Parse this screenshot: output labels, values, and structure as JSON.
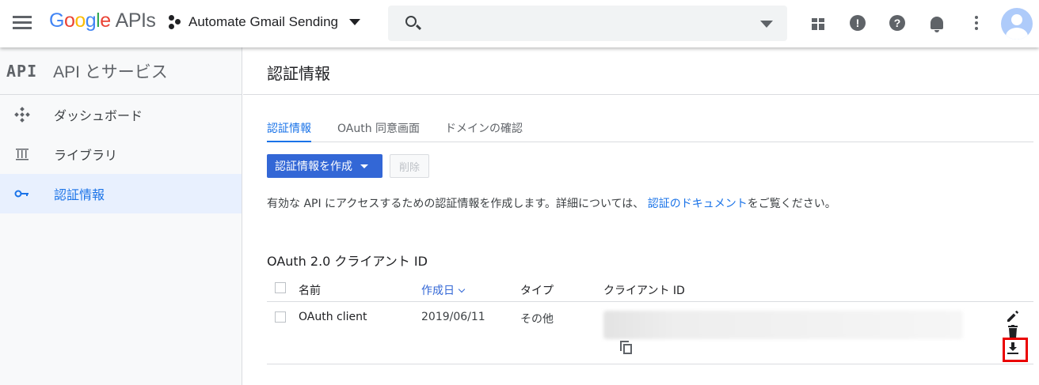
{
  "header": {
    "logo": {
      "g1": "G",
      "g2": "o",
      "g3": "o",
      "g4": "g",
      "g5": "l",
      "g6": "e",
      "apis": "APIs"
    },
    "project_name": "Automate Gmail Sending",
    "search_placeholder": ""
  },
  "icons": {
    "menu": "hamburger-icon",
    "gift": "gift-icon",
    "feedback": "feedback-icon",
    "help": "help-icon",
    "notifications": "bell-icon",
    "more": "more-vert-icon",
    "avatar": "account-icon",
    "copy": "copy-icon",
    "edit": "pencil-icon",
    "delete": "trash-icon",
    "download": "download-icon"
  },
  "sidebar": {
    "mark": "API",
    "title": "API とサービス",
    "items": [
      {
        "label": "ダッシュボード",
        "icon": "dashboard-icon",
        "active": false
      },
      {
        "label": "ライブラリ",
        "icon": "library-icon",
        "active": false
      },
      {
        "label": "認証情報",
        "icon": "key-icon",
        "active": true
      }
    ]
  },
  "main": {
    "title": "認証情報",
    "tabs": [
      {
        "label": "認証情報",
        "active": true
      },
      {
        "label": "OAuth 同意画面",
        "active": false
      },
      {
        "label": "ドメインの確認",
        "active": false
      }
    ],
    "create_button": "認証情報を作成",
    "delete_button": "削除",
    "description_before": "有効な API にアクセスするための認証情報を作成します。詳細については、 ",
    "description_link": "認証のドキュメント",
    "description_after": "をご覧ください。",
    "section_title": "OAuth 2.0 クライアント ID",
    "table": {
      "columns": [
        "名前",
        "作成日",
        "タイプ",
        "クライアント ID"
      ],
      "rows": [
        {
          "name": "OAuth client",
          "created": "2019/06/11",
          "type": "その他",
          "client_id": ""
        }
      ]
    }
  },
  "colors": {
    "accent": "#1a73e8",
    "primary_button": "#3367d6",
    "highlight_box": "#ea0000"
  }
}
